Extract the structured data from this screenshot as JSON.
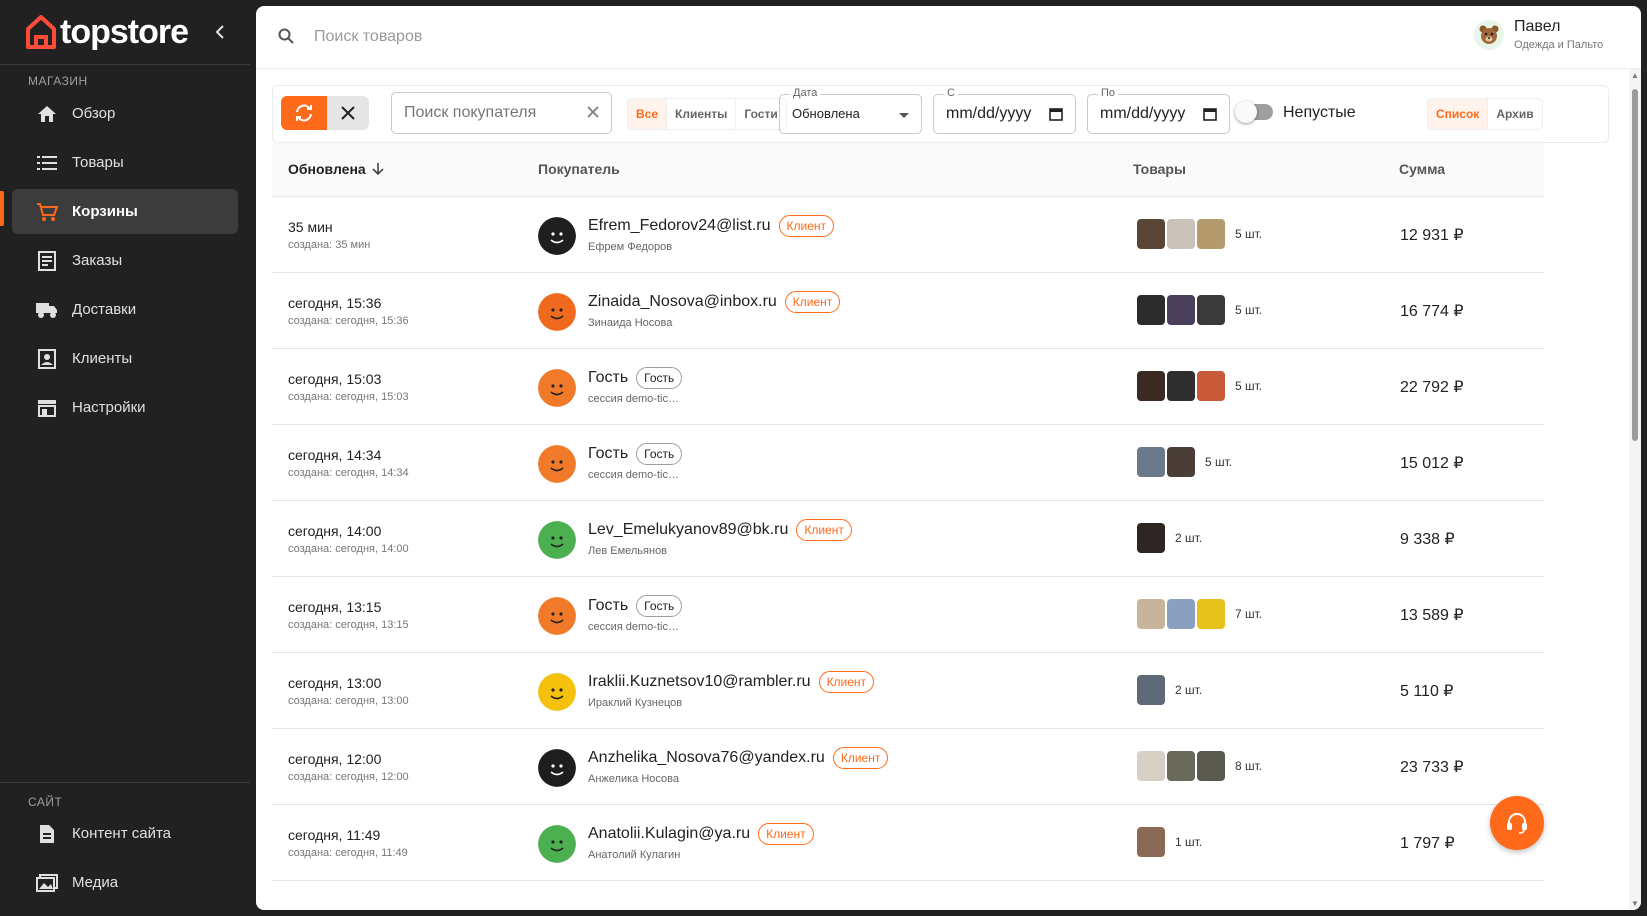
{
  "brand": {
    "name": "topstore",
    "accent": "#ff6a1a"
  },
  "sidebar": {
    "section_shop": "МАГАЗИН",
    "items": [
      {
        "label": "Обзор",
        "icon": "home-icon"
      },
      {
        "label": "Товары",
        "icon": "list-icon"
      },
      {
        "label": "Корзины",
        "icon": "cart-icon",
        "active": true
      },
      {
        "label": "Заказы",
        "icon": "orders-icon"
      },
      {
        "label": "Доставки",
        "icon": "truck-icon"
      },
      {
        "label": "Клиенты",
        "icon": "contacts-icon"
      },
      {
        "label": "Настройки",
        "icon": "store-icon"
      }
    ],
    "section_site": "САЙТ",
    "site_items": [
      {
        "label": "Контент сайта",
        "icon": "document-icon"
      },
      {
        "label": "Медиа",
        "icon": "images-icon"
      }
    ]
  },
  "topbar": {
    "search_placeholder": "Поиск товаров",
    "user_name": "Павел",
    "user_store": "Одежда и Пальто"
  },
  "filters": {
    "buyer_placeholder": "Поиск покупателя",
    "segments": [
      "Все",
      "Клиенты",
      "Гости"
    ],
    "date_label": "Дата",
    "date_value": "Обновлена",
    "from_label": "С",
    "from_value": "mm/dd/yyyy",
    "to_label": "По",
    "to_value": "mm/dd/yyyy",
    "nonempty_label": "Непустые",
    "nonempty_on": false,
    "views": [
      "Список",
      "Архив"
    ]
  },
  "table": {
    "headers": {
      "updated": "Обновлена",
      "buyer": "Покупатель",
      "goods": "Товары",
      "sum": "Сумма"
    },
    "rows": [
      {
        "updated": "35 мин",
        "created": "создана: 35 мин",
        "title": "Efrem_Fedorov24@list.ru",
        "badge": "Клиент",
        "type": "client",
        "sub": "Ефрем Федоров",
        "count": "5 шт.",
        "sum": "12 931 ₽",
        "thumbs": [
          "#5a4636",
          "#c9c2b8",
          "#b59a6e"
        ],
        "avatar": "#1e1e1e"
      },
      {
        "updated": "сегодня, 15:36",
        "created": "создана: сегодня, 15:36",
        "title": "Zinaida_Nosova@inbox.ru",
        "badge": "Клиент",
        "type": "client",
        "sub": "Зинаида Носова",
        "count": "5 шт.",
        "sum": "16 774 ₽",
        "thumbs": [
          "#2b2b2b",
          "#4a3f5a",
          "#3a3a3a"
        ],
        "avatar": "#f06a1e"
      },
      {
        "updated": "сегодня, 15:03",
        "created": "создана: сегодня, 15:03",
        "title": "Гость",
        "badge": "Гость",
        "type": "guest",
        "sub": "сессия demo-tic…",
        "count": "5 шт.",
        "sum": "22 792 ₽",
        "thumbs": [
          "#3a2a22",
          "#2e2e2e",
          "#c85a3a"
        ],
        "avatar": "#f07a2a"
      },
      {
        "updated": "сегодня, 14:34",
        "created": "создана: сегодня, 14:34",
        "title": "Гость",
        "badge": "Гость",
        "type": "guest",
        "sub": "сессия demo-tic…",
        "count": "5 шт.",
        "sum": "15 012 ₽",
        "thumbs": [
          "#6a7a8a",
          "#4a3e36"
        ],
        "avatar": "#f07a2a"
      },
      {
        "updated": "сегодня, 14:00",
        "created": "создана: сегодня, 14:00",
        "title": "Lev_Emelukyanov89@bk.ru",
        "badge": "Клиент",
        "type": "client",
        "sub": "Лев Емельянов",
        "count": "2 шт.",
        "sum": "9 338 ₽",
        "thumbs": [
          "#2e2622"
        ],
        "avatar": "#4caf50"
      },
      {
        "updated": "сегодня, 13:15",
        "created": "создана: сегодня, 13:15",
        "title": "Гость",
        "badge": "Гость",
        "type": "guest",
        "sub": "сессия demo-tic…",
        "count": "7 шт.",
        "sum": "13 589 ₽",
        "thumbs": [
          "#c7b49a",
          "#8aa0c0",
          "#e6c21a"
        ],
        "avatar": "#f07a2a"
      },
      {
        "updated": "сегодня, 13:00",
        "created": "создана: сегодня, 13:00",
        "title": "Iraklii.Kuznetsov10@rambler.ru",
        "badge": "Клиент",
        "type": "client",
        "sub": "Ираклий Кузнецов",
        "count": "2 шт.",
        "sum": "5 110 ₽",
        "thumbs": [
          "#5e6a78"
        ],
        "avatar": "#f4c20d"
      },
      {
        "updated": "сегодня, 12:00",
        "created": "создана: сегодня, 12:00",
        "title": "Anzhelika_Nosova76@yandex.ru",
        "badge": "Клиент",
        "type": "client",
        "sub": "Анжелика Носова",
        "count": "8 шт.",
        "sum": "23 733 ₽",
        "thumbs": [
          "#d8d0c4",
          "#6a6a5a",
          "#5a5a4e"
        ],
        "avatar": "#1e1e1e"
      },
      {
        "updated": "сегодня, 11:49",
        "created": "создана: сегодня, 11:49",
        "title": "Anatolii.Kulagin@ya.ru",
        "badge": "Клиент",
        "type": "client",
        "sub": "Анатолий Кулагин",
        "count": "1 шт.",
        "sum": "1 797 ₽",
        "thumbs": [
          "#8a6a56"
        ],
        "avatar": "#4caf50"
      }
    ]
  }
}
